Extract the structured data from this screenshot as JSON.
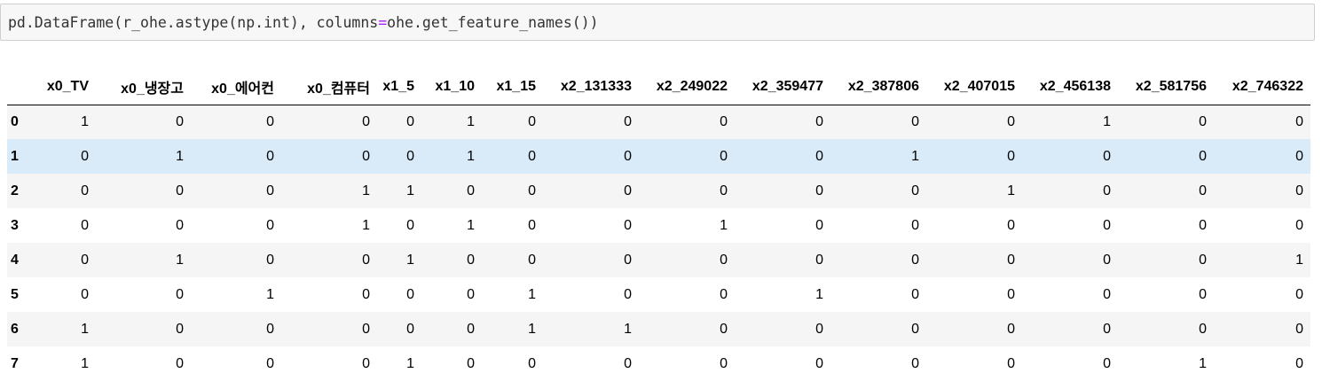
{
  "code_cell": {
    "prefix": "pd.DataFrame(r_ohe.astype(np.int), columns",
    "operator": "=",
    "suffix": "ohe.get_feature_names())"
  },
  "dataframe": {
    "columns": [
      "x0_TV",
      "x0_냉장고",
      "x0_에어컨",
      "x0_컴퓨터",
      "x1_5",
      "x1_10",
      "x1_15",
      "x2_131333",
      "x2_249022",
      "x2_359477",
      "x2_387806",
      "x2_407015",
      "x2_456138",
      "x2_581756",
      "x2_746322"
    ],
    "rows": [
      {
        "index": "0",
        "values": [
          "1",
          "0",
          "0",
          "0",
          "0",
          "1",
          "0",
          "0",
          "0",
          "0",
          "0",
          "0",
          "1",
          "0",
          "0"
        ]
      },
      {
        "index": "1",
        "values": [
          "0",
          "1",
          "0",
          "0",
          "0",
          "1",
          "0",
          "0",
          "0",
          "0",
          "1",
          "0",
          "0",
          "0",
          "0"
        ]
      },
      {
        "index": "2",
        "values": [
          "0",
          "0",
          "0",
          "1",
          "1",
          "0",
          "0",
          "0",
          "0",
          "0",
          "0",
          "1",
          "0",
          "0",
          "0"
        ]
      },
      {
        "index": "3",
        "values": [
          "0",
          "0",
          "0",
          "1",
          "0",
          "1",
          "0",
          "0",
          "1",
          "0",
          "0",
          "0",
          "0",
          "0",
          "0"
        ]
      },
      {
        "index": "4",
        "values": [
          "0",
          "1",
          "0",
          "0",
          "1",
          "0",
          "0",
          "0",
          "0",
          "0",
          "0",
          "0",
          "0",
          "0",
          "1"
        ]
      },
      {
        "index": "5",
        "values": [
          "0",
          "0",
          "1",
          "0",
          "0",
          "0",
          "1",
          "0",
          "0",
          "1",
          "0",
          "0",
          "0",
          "0",
          "0"
        ]
      },
      {
        "index": "6",
        "values": [
          "1",
          "0",
          "0",
          "0",
          "0",
          "0",
          "1",
          "1",
          "0",
          "0",
          "0",
          "0",
          "0",
          "0",
          "0"
        ]
      },
      {
        "index": "7",
        "values": [
          "1",
          "0",
          "0",
          "0",
          "1",
          "0",
          "0",
          "0",
          "0",
          "0",
          "0",
          "0",
          "0",
          "1",
          "0"
        ]
      }
    ],
    "highlighted_row": 1,
    "colors": {
      "odd_row": "#f5f5f5",
      "even_row": "#ffffff",
      "hover_row": "#d9ebf9",
      "code_background": "#f7f7f7",
      "operator": "#aa22ff"
    }
  }
}
